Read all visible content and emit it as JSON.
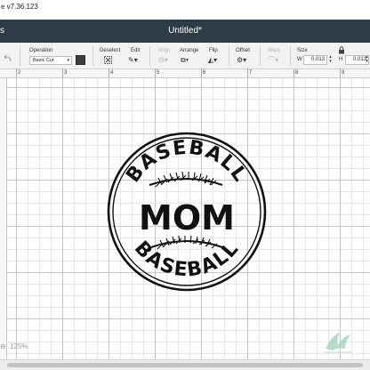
{
  "app": {
    "version_text": "e v7.36.123",
    "title_left": "s",
    "title": "Untitled*"
  },
  "toolbar": {
    "operation": {
      "label": "Operation",
      "value": "Basic Cut",
      "color": "#3c3c3c"
    },
    "deselect_label": "Deselect",
    "edit_label": "Edit",
    "align_label": "Align",
    "arrange_label": "Arrange",
    "flip_label": "Flip",
    "offset_label": "Offset",
    "warp_label": "Warp",
    "size": {
      "label": "Size",
      "w_label": "W",
      "w_value": "0.013",
      "h_label": "H",
      "h_value": "0.013"
    }
  },
  "ruler": {
    "h_numbers": [
      "2",
      "3",
      "4",
      "5",
      "6",
      "7",
      "8",
      "9"
    ]
  },
  "design": {
    "arc_top": "BASEBALL",
    "center": "MOM",
    "arc_bottom": "BASEBALL"
  },
  "zoom": {
    "value": "125%"
  },
  "colors": {
    "title_bar": "#2f3b47",
    "toolbar": "#f1f2f2",
    "watermark": "#9ccfb8"
  }
}
